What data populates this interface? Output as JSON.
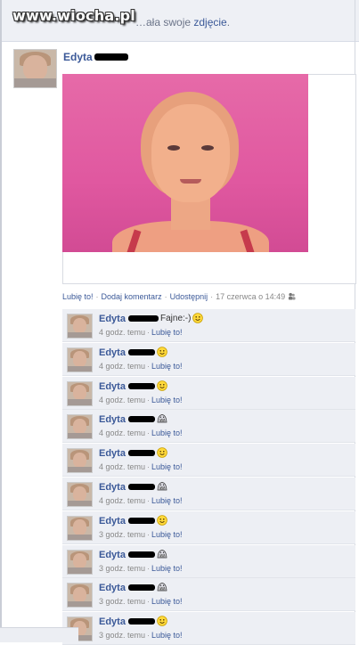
{
  "watermark": "www.wiocha.pl",
  "story": {
    "text_prefix": "…ała swoje ",
    "text_link": "zdjęcie",
    "text_suffix": "."
  },
  "post": {
    "author": "Edyta",
    "actions": {
      "like": "Lubię to!",
      "comment": "Dodaj komentarz",
      "share": "Udostępnij",
      "timestamp": "17 czerwca o 14:49"
    }
  },
  "comments": [
    {
      "name": "Edyta",
      "text": "Fajne:-)",
      "emoticon": "smile",
      "time": "4 godz. temu",
      "like": "Lubię to!"
    },
    {
      "name": "Edyta",
      "text": "",
      "emoticon": "smile",
      "time": "4 godz. temu",
      "like": "Lubię to!"
    },
    {
      "name": "Edyta",
      "text": "",
      "emoticon": "smile",
      "time": "4 godz. temu",
      "like": "Lubię to!"
    },
    {
      "name": "Edyta",
      "text": "",
      "emoticon": "shark",
      "time": "4 godz. temu",
      "like": "Lubię to!"
    },
    {
      "name": "Edyta",
      "text": "",
      "emoticon": "smile",
      "time": "4 godz. temu",
      "like": "Lubię to!"
    },
    {
      "name": "Edyta",
      "text": "",
      "emoticon": "shark",
      "time": "4 godz. temu",
      "like": "Lubię to!"
    },
    {
      "name": "Edyta",
      "text": "",
      "emoticon": "smile",
      "time": "3 godz. temu",
      "like": "Lubię to!"
    },
    {
      "name": "Edyta",
      "text": "",
      "emoticon": "shark",
      "time": "3 godz. temu",
      "like": "Lubię to!"
    },
    {
      "name": "Edyta",
      "text": "",
      "emoticon": "shark",
      "time": "3 godz. temu",
      "like": "Lubię to!"
    },
    {
      "name": "Edyta",
      "text": "",
      "emoticon": "smile",
      "time": "3 godz. temu",
      "like": "Lubię to!"
    }
  ],
  "colors": {
    "link": "#3b5998",
    "comment_bg": "#edeff4",
    "photo_bg": "#e05ea0"
  }
}
